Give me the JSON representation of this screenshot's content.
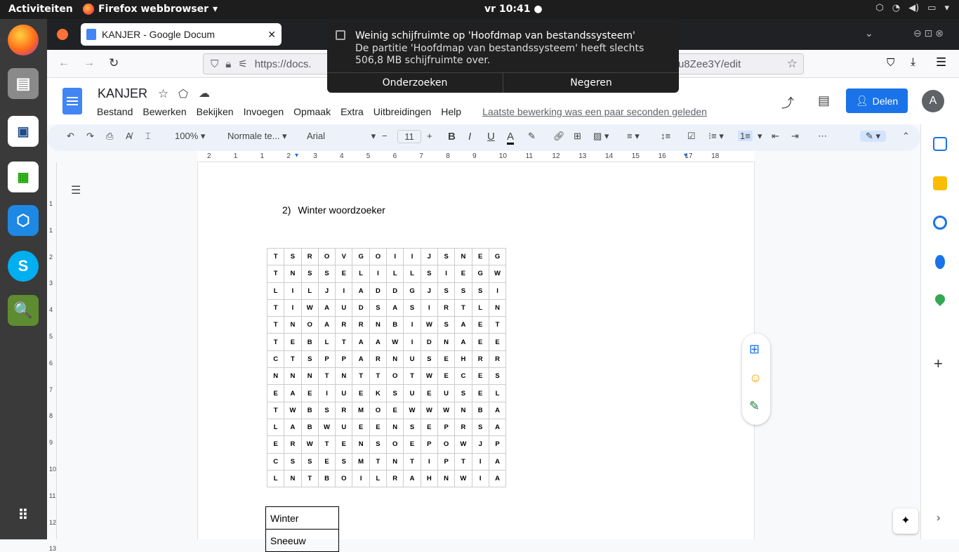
{
  "topbar": {
    "activities": "Activiteiten",
    "app": "Firefox webbrowser",
    "clock": "vr 10:41"
  },
  "browser": {
    "tab_title": "KANJER - Google Docum",
    "url": "https://docs.",
    "url_end": "u8Zee3Y/edit"
  },
  "docs": {
    "title": "KANJER",
    "menus": [
      "Bestand",
      "Bewerken",
      "Bekijken",
      "Invoegen",
      "Opmaak",
      "Extra",
      "Uitbreidingen",
      "Help"
    ],
    "last_edit": "Laatste bewerking was een paar seconden geleden",
    "share": "Delen",
    "avatar": "A"
  },
  "toolbar": {
    "zoom": "100%",
    "style": "Normale te...",
    "font": "Arial",
    "size": "11"
  },
  "ruler": [
    "2",
    "1",
    "1",
    "2",
    "3",
    "4",
    "5",
    "6",
    "7",
    "8",
    "9",
    "10",
    "11",
    "12",
    "13",
    "14",
    "15",
    "16",
    "17",
    "18"
  ],
  "vruler": [
    "1",
    "1",
    "2",
    "3",
    "4",
    "5",
    "6",
    "7",
    "8",
    "9",
    "10",
    "11",
    "12",
    "13"
  ],
  "document": {
    "heading_num": "2)",
    "heading": "Winter woordzoeker",
    "grid": [
      [
        "T",
        "S",
        "R",
        "O",
        "V",
        "G",
        "O",
        "I",
        "I",
        "J",
        "S",
        "N",
        "E",
        "G"
      ],
      [
        "T",
        "N",
        "S",
        "S",
        "E",
        "L",
        "I",
        "L",
        "L",
        "S",
        "I",
        "E",
        "G",
        "W"
      ],
      [
        "L",
        "I",
        "L",
        "J",
        "I",
        "A",
        "D",
        "D",
        "G",
        "J",
        "S",
        "S",
        "S",
        "I"
      ],
      [
        "T",
        "I",
        "W",
        "A",
        "U",
        "D",
        "S",
        "A",
        "S",
        "I",
        "R",
        "T",
        "L",
        "N"
      ],
      [
        "T",
        "N",
        "O",
        "A",
        "R",
        "R",
        "N",
        "B",
        "I",
        "W",
        "S",
        "A",
        "E",
        "T"
      ],
      [
        "T",
        "E",
        "B",
        "L",
        "T",
        "A",
        "A",
        "W",
        "I",
        "D",
        "N",
        "A",
        "E",
        "E"
      ],
      [
        "C",
        "T",
        "S",
        "P",
        "P",
        "A",
        "R",
        "N",
        "U",
        "S",
        "E",
        "H",
        "R",
        "R"
      ],
      [
        "N",
        "N",
        "N",
        "T",
        "N",
        "T",
        "T",
        "O",
        "T",
        "W",
        "E",
        "C",
        "E",
        "S"
      ],
      [
        "E",
        "A",
        "E",
        "I",
        "U",
        "E",
        "K",
        "S",
        "U",
        "E",
        "U",
        "S",
        "E",
        "L"
      ],
      [
        "T",
        "W",
        "B",
        "S",
        "R",
        "M",
        "O",
        "E",
        "W",
        "W",
        "W",
        "N",
        "B",
        "A"
      ],
      [
        "L",
        "A",
        "B",
        "W",
        "U",
        "E",
        "E",
        "N",
        "S",
        "E",
        "P",
        "R",
        "S",
        "A"
      ],
      [
        "E",
        "R",
        "W",
        "T",
        "E",
        "N",
        "S",
        "O",
        "E",
        "P",
        "O",
        "W",
        "J",
        "P"
      ],
      [
        "C",
        "S",
        "S",
        "E",
        "S",
        "M",
        "T",
        "N",
        "T",
        "I",
        "P",
        "T",
        "I",
        "A"
      ],
      [
        "L",
        "N",
        "T",
        "B",
        "O",
        "I",
        "L",
        "R",
        "A",
        "H",
        "N",
        "W",
        "I",
        "A"
      ]
    ],
    "words": [
      "Winter",
      "Sneeuw"
    ]
  },
  "notification": {
    "title": "Weinig schijfruimte op 'Hoofdmap van bestandssysteem'",
    "body": "De partitie 'Hoofdmap van bestandssysteem' heeft slechts 506,8 MB schijfruimte over.",
    "action1": "Onderzoeken",
    "action2": "Negeren"
  },
  "colors": {
    "accent": "#1a73e8",
    "topbar": "#1d1d1d",
    "dock": "#3a3a3a"
  }
}
